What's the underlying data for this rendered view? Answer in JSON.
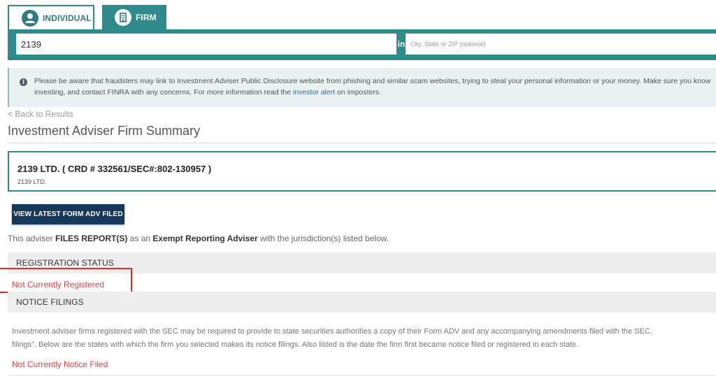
{
  "tabs": {
    "individual": "INDIVIDUAL",
    "firm": "FIRM"
  },
  "search": {
    "value": "2139",
    "in_label": "in",
    "location_placeholder": "City, State or ZIP (optional)"
  },
  "alert": {
    "line1": "Please be aware that fraudsters may link to Investment Adviser Public Disclosure website from phishing and similar scam websites, trying to steal your personal information or your money. Make sure you know",
    "line2_pre": "investing, and contact FINRA with any concerns. For more information read the ",
    "link": "investor alert",
    "line2_post": " on imposters."
  },
  "back_link": "< Back to Results",
  "page_title": "Investment Adviser Firm Summary",
  "firm": {
    "heading": "2139 LTD. ( CRD # 332561/SEC#:802-130957 )",
    "subname": "2139 LTD."
  },
  "adv_button": "VIEW LATEST FORM ADV FILED",
  "report_line": {
    "pre": "This adviser ",
    "bold1": "FILES REPORT(S)",
    "mid": " as an ",
    "bold2": "Exempt Reporting Adviser",
    "post": " with the jurisdiction(s) listed below."
  },
  "registration": {
    "header": "REGISTRATION STATUS",
    "status": "Not Currently Registered"
  },
  "notice": {
    "header": "NOTICE FILINGS",
    "line1": "Investment adviser firms registered with the SEC may be required to provide to state securities authorities a copy of their Form ADV and any accompanying amendments filed with the SEC.",
    "line2": "filings\". Below are the states with which the firm you selected makes its notice filings. Also listed is the date the firm first became notice filed or registered in each state.",
    "status": "Not Currently Notice Filed"
  },
  "colors": {
    "teal": "#2f8a8c",
    "navy_button": "#14375a",
    "status_red": "#d64545",
    "highlight_red": "#e32a2a"
  },
  "icons": {
    "individual_tab": "person-icon",
    "firm_tab": "building-icon",
    "alert": "info-icon"
  }
}
